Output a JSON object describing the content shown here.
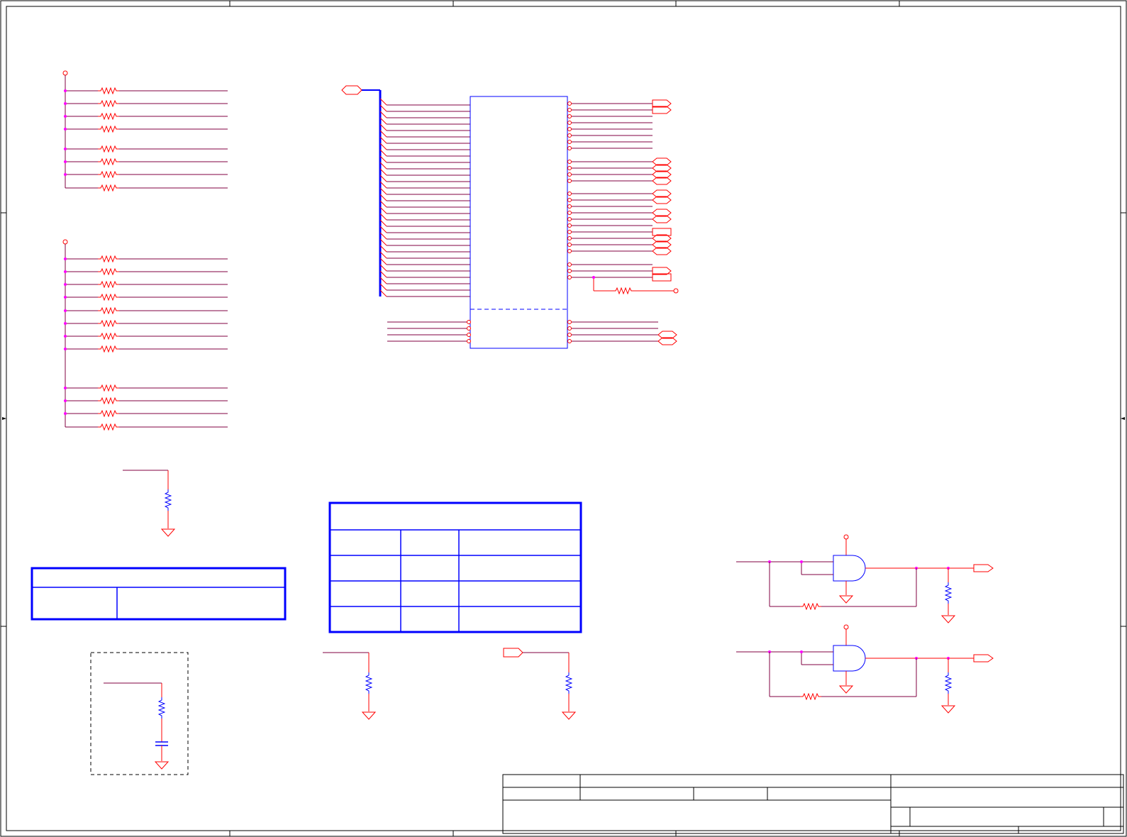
{
  "colors": {
    "background": "#ffffff",
    "border": "#000000",
    "wire": "#ff0000",
    "net": "#800040",
    "component": "#0000ff",
    "junction": "#ff00ff"
  },
  "icons": {
    "resistor": "resistor-icon",
    "ground": "ground-icon",
    "power": "power-pin-icon",
    "port": "port-connector-icon",
    "capacitor": "capacitor-icon",
    "gate": "and-gate-icon"
  }
}
